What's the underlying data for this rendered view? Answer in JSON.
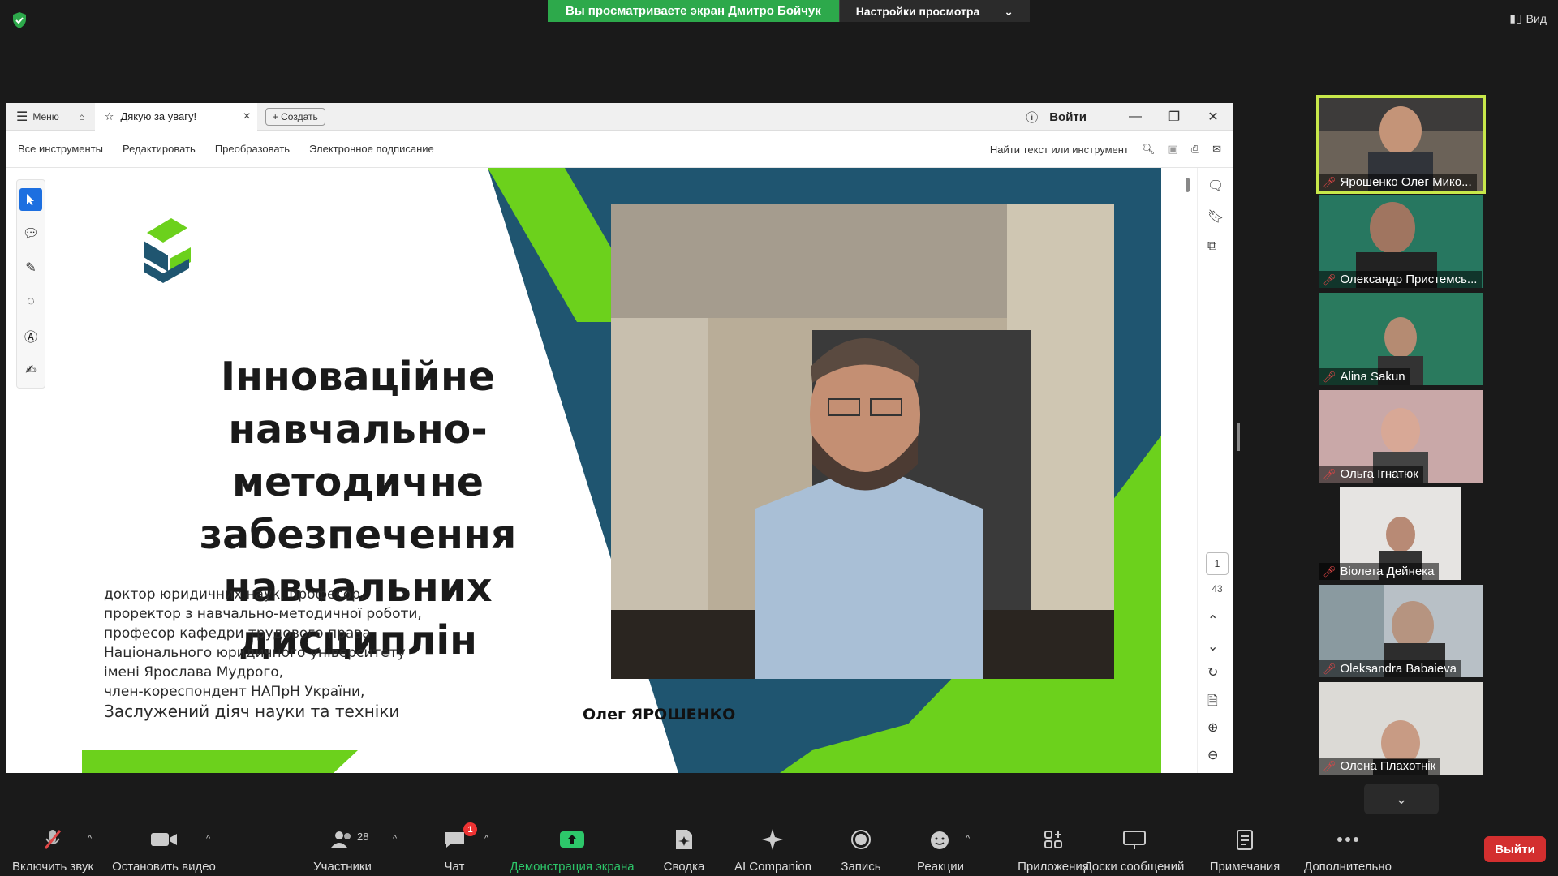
{
  "banner": {
    "sharing": "Вы просматриваете экран Дмитро Бойчук",
    "view_options": "Настройки просмотра"
  },
  "view_button": "Вид",
  "acrobat": {
    "menu": "Меню",
    "tab_title": "Дякую за увагу!",
    "create": "Создать",
    "login": "Войти",
    "toolbar": [
      "Все инструменты",
      "Редактировать",
      "Преобразовать",
      "Электронное подписание"
    ],
    "search_placeholder": "Найти текст или инструмент",
    "page_current": "1",
    "page_total": "43"
  },
  "slide": {
    "title_lines": [
      "Інноваційне",
      "навчально-методичне",
      "забезпечення",
      "навчальних дисциплін"
    ],
    "desc_lines": [
      "доктор юридичних наук, професор,",
      "проректор з навчально-методичної роботи,",
      "професор кафедри трудового права",
      "Національного юридичного університету",
      "імені Ярослава Мудрого,",
      "член-кореспондент НАПрН України,"
    ],
    "desc_last": "Заслужений діяч науки та техніки",
    "name": "Олег ЯРОШЕНКО",
    "colors": {
      "green": "#6cd11c",
      "blue": "#1f5570"
    }
  },
  "participants": [
    {
      "name": "Ярошенко Олег Мико...",
      "active": true
    },
    {
      "name": "Олександр Пристемсь..."
    },
    {
      "name": "Alina Sakun"
    },
    {
      "name": "Ольга Ігнатюк"
    },
    {
      "name": "Віолета Дейнека"
    },
    {
      "name": "Oleksandra Babaieva"
    },
    {
      "name": "Олена Плахотнік"
    }
  ],
  "bottom_bar": {
    "unmute": "Включить звук",
    "stop_video": "Остановить видео",
    "participants": "Участники",
    "participants_count": "28",
    "chat": "Чат",
    "chat_badge": "1",
    "share": "Демонстрация экрана",
    "summary": "Сводка",
    "ai": "AI Companion",
    "record": "Запись",
    "reactions": "Реакции",
    "apps": "Приложения",
    "whiteboards": "Доски сообщений",
    "notes": "Примечания",
    "more": "Дополнительно",
    "leave": "Выйти"
  }
}
